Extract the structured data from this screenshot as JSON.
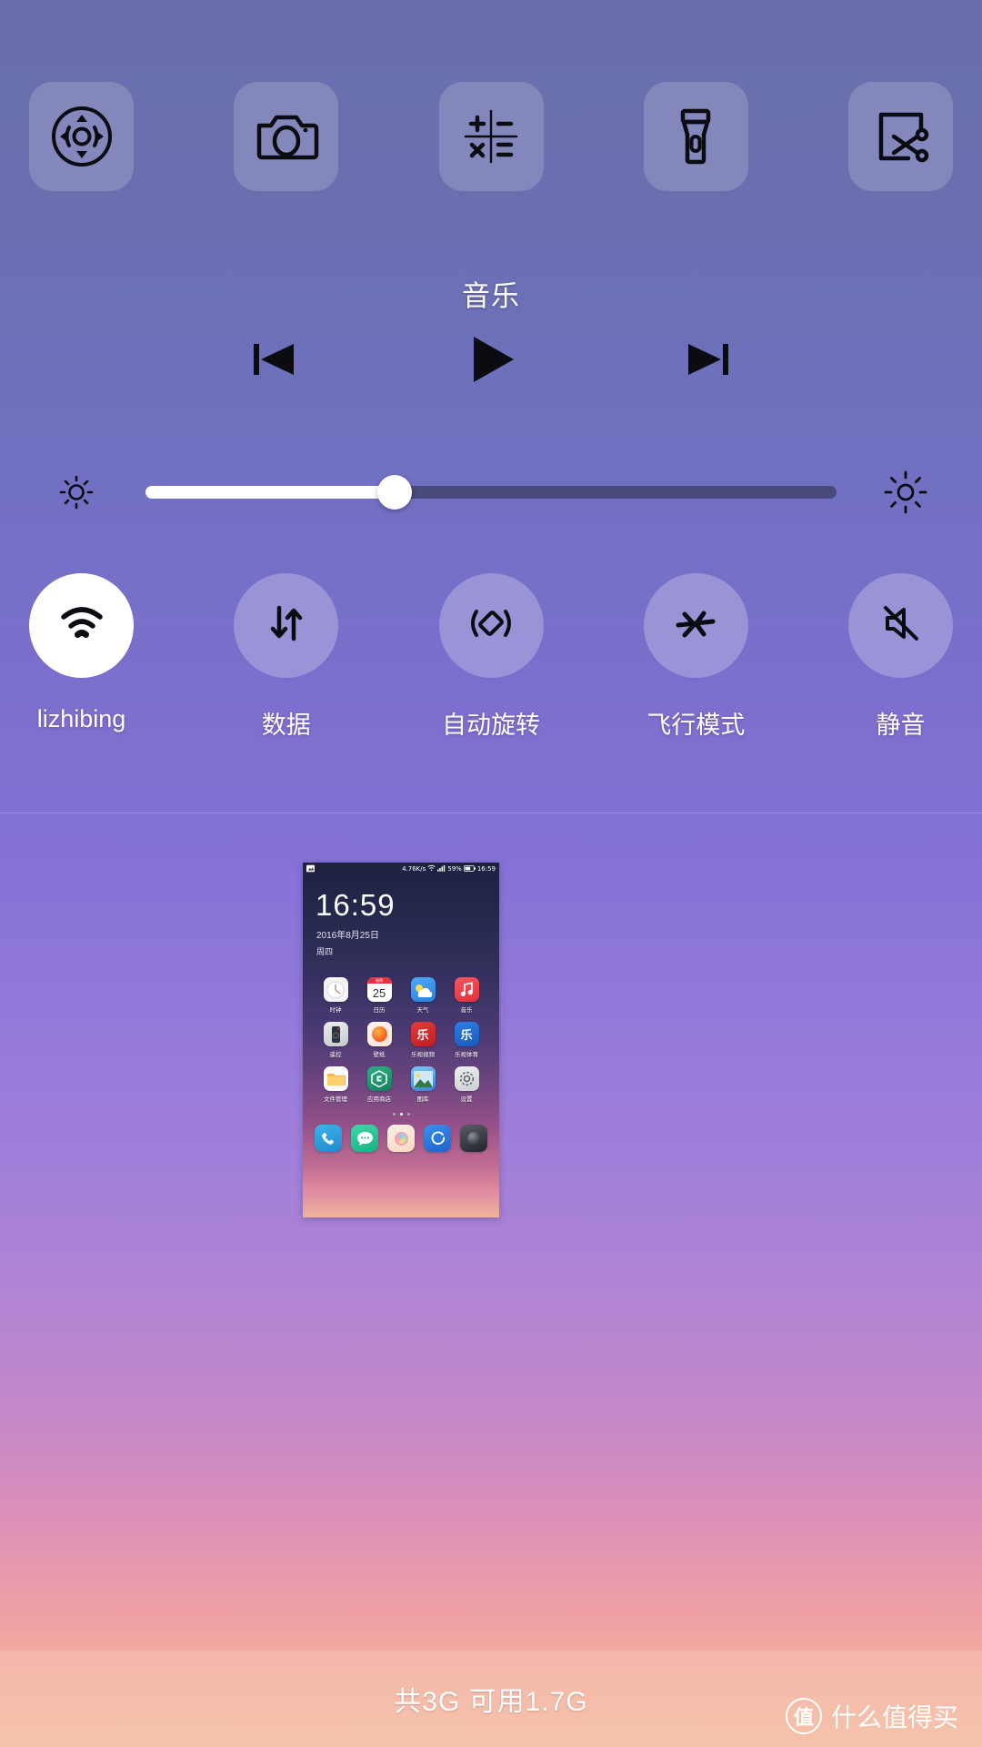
{
  "shortcuts": [
    {
      "name": "dpad-control-icon",
      "label": "方向控制"
    },
    {
      "name": "camera-icon",
      "label": "相机"
    },
    {
      "name": "calculator-icon",
      "label": "计算器"
    },
    {
      "name": "flashlight-icon",
      "label": "手电筒"
    },
    {
      "name": "screenshot-scissors-icon",
      "label": "截屏"
    }
  ],
  "music": {
    "title": "音乐",
    "prev_label": "上一首",
    "play_label": "播放",
    "next_label": "下一首"
  },
  "brightness": {
    "low_icon": "brightness-low-icon",
    "high_icon": "brightness-high-icon",
    "value_percent": 36
  },
  "toggles": [
    {
      "icon": "wifi-icon",
      "label": "lizhibing",
      "active": true
    },
    {
      "icon": "mobile-data-icon",
      "label": "数据",
      "active": false
    },
    {
      "icon": "auto-rotate-icon",
      "label": "自动旋转",
      "active": false
    },
    {
      "icon": "airplane-icon",
      "label": "飞行模式",
      "active": false
    },
    {
      "icon": "mute-icon",
      "label": "静音",
      "active": false
    }
  ],
  "preview": {
    "status_bar": {
      "left_icon": "image-icon",
      "net_speed": "4.76K/s",
      "wifi_icon": "wifi-icon",
      "signal_icon": "signal-icon",
      "battery_percent": "59%",
      "battery_icon": "battery-icon",
      "time": "16:59"
    },
    "clock": "16:59",
    "date": "2016年8月25日",
    "weekday": "周四",
    "apps": [
      {
        "name": "时钟",
        "icon": "clock-app-icon"
      },
      {
        "name": "日历",
        "icon": "calendar-app-icon",
        "day": "25",
        "header": "周四"
      },
      {
        "name": "天气",
        "icon": "weather-app-icon"
      },
      {
        "name": "音乐",
        "icon": "music-app-icon"
      },
      {
        "name": "遥控",
        "icon": "remote-app-icon"
      },
      {
        "name": "壁纸",
        "icon": "wallpaper-app-icon"
      },
      {
        "name": "乐视视频",
        "icon": "letv-video-app-icon"
      },
      {
        "name": "乐视体育",
        "icon": "letv-sports-app-icon"
      },
      {
        "name": "文件管理",
        "icon": "file-manager-app-icon"
      },
      {
        "name": "应用商店",
        "icon": "app-store-app-icon"
      },
      {
        "name": "图库",
        "icon": "gallery-app-icon"
      },
      {
        "name": "设置",
        "icon": "settings-app-icon"
      }
    ],
    "page_dots": 3,
    "active_dot": 1,
    "dock": [
      {
        "name": "phone-dock-icon"
      },
      {
        "name": "messages-dock-icon"
      },
      {
        "name": "camera-dock-icon"
      },
      {
        "name": "browser-dock-icon"
      },
      {
        "name": "clean-dock-icon"
      }
    ]
  },
  "bottom": {
    "storage_text": "共3G 可用1.7G",
    "watermark_badge": "值",
    "watermark_text": "什么值得买"
  }
}
